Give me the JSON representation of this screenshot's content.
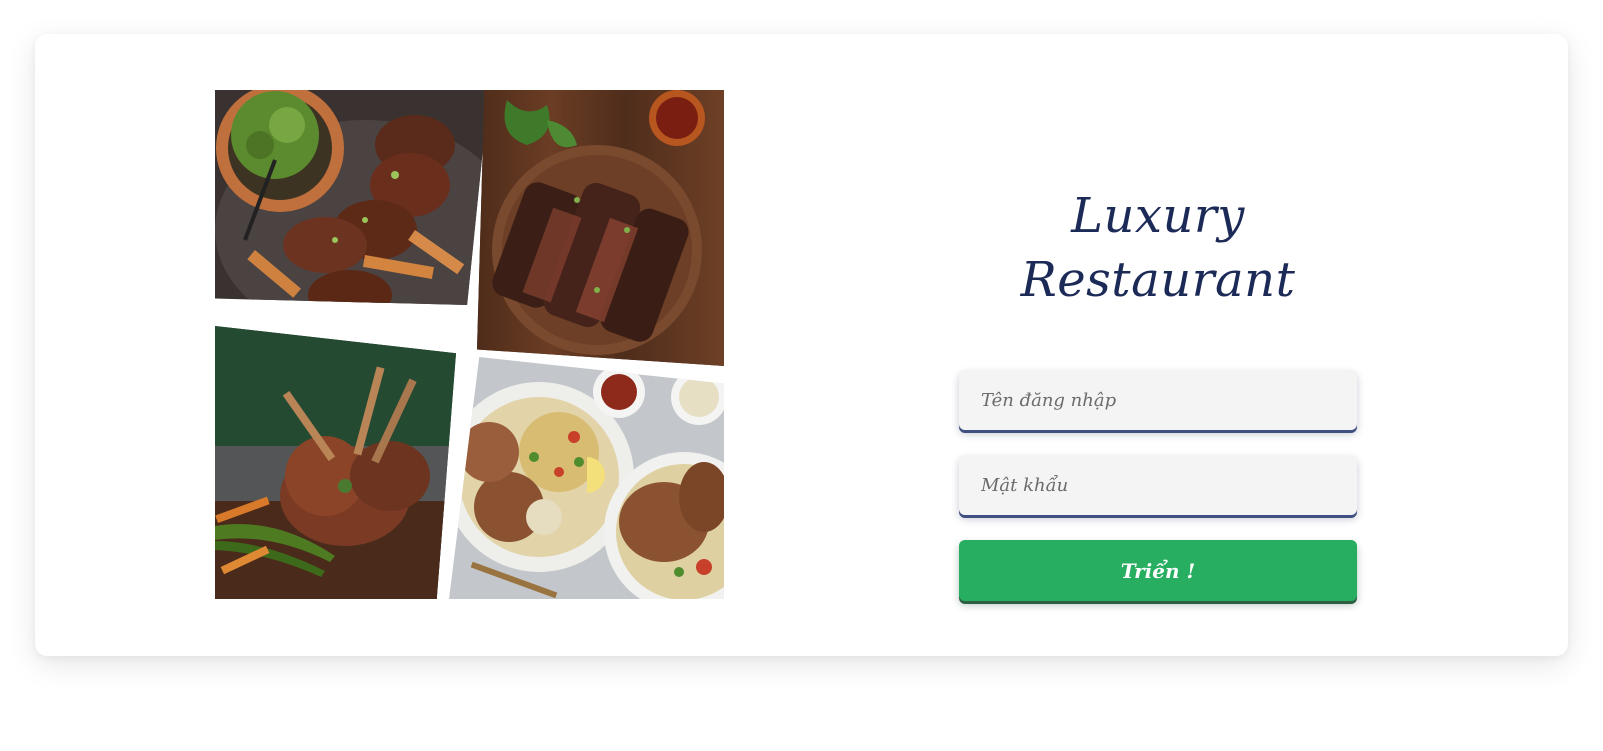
{
  "app": {
    "title": "Luxury Restaurant"
  },
  "login_form": {
    "username": {
      "value": "",
      "placeholder": "Tên đăng nhập"
    },
    "password": {
      "value": "",
      "placeholder": "Mật khẩu"
    },
    "submit_label": "Triển !"
  },
  "colors": {
    "title": "#1b2a56",
    "submit_button": "#27ae60",
    "input_background": "#f4f4f5"
  }
}
